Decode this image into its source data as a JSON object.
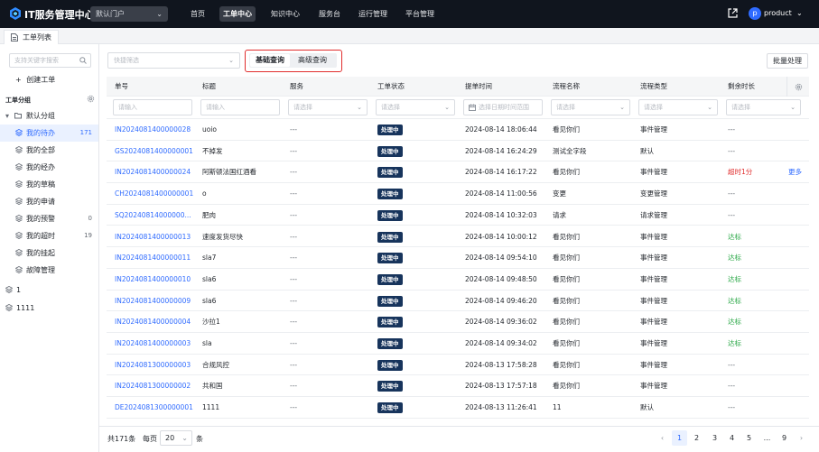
{
  "app": {
    "title": "IT服务管理中心",
    "portal": "默认门户",
    "nav": [
      "首页",
      "工单中心",
      "知识中心",
      "服务台",
      "运行管理",
      "平台管理"
    ],
    "active_nav": "工单中心",
    "user_initial": "p",
    "user": "product"
  },
  "tab": {
    "label": "工单列表"
  },
  "sidebar": {
    "search_placeholder": "支持关键字搜索",
    "create_label": "创建工单",
    "group_header": "工单分组",
    "root": "默认分组",
    "items": [
      {
        "label": "我的待办",
        "count": "171",
        "active": true
      },
      {
        "label": "我的全部",
        "count": ""
      },
      {
        "label": "我的经办",
        "count": ""
      },
      {
        "label": "我的草稿",
        "count": ""
      },
      {
        "label": "我的申请",
        "count": ""
      },
      {
        "label": "我的预警",
        "count": "0"
      },
      {
        "label": "我的超时",
        "count": "19"
      },
      {
        "label": "我的挂起",
        "count": ""
      },
      {
        "label": "故障管理",
        "count": ""
      }
    ],
    "extra_groups": [
      "1",
      "1111"
    ]
  },
  "toolbar": {
    "quick_filter_placeholder": "快捷筛选",
    "basic_query": "基础查询",
    "advanced_query": "高级查询",
    "batch_label": "批量处理"
  },
  "table": {
    "columns": [
      "单号",
      "标题",
      "服务",
      "工单状态",
      "提单时间",
      "流程名称",
      "流程类型",
      "剩余时长"
    ],
    "filters": {
      "input": "请输入",
      "select": "请选择",
      "date": "选择日期时间范围"
    },
    "rows": [
      {
        "id": "IN2024081400000028",
        "title": "uoio",
        "service": "---",
        "status": "处理中",
        "time": "2024-08-14 18:06:44",
        "process": "看见你们",
        "type": "事件管理",
        "remaining": "---",
        "remaining_kind": "dash",
        "more": ""
      },
      {
        "id": "GS2024081400000001",
        "title": "不掉发",
        "service": "---",
        "status": "处理中",
        "time": "2024-08-14 16:24:29",
        "process": "测试全字段",
        "type": "默认",
        "remaining": "---",
        "remaining_kind": "dash",
        "more": ""
      },
      {
        "id": "IN2024081400000024",
        "title": "阿斯顿法国红酒看",
        "service": "---",
        "status": "处理中",
        "time": "2024-08-14 16:17:22",
        "process": "看见你们",
        "type": "事件管理",
        "remaining": "超时1分",
        "remaining_kind": "over",
        "more": "更多"
      },
      {
        "id": "CH2024081400000001",
        "title": "o",
        "service": "---",
        "status": "处理中",
        "time": "2024-08-14 11:00:56",
        "process": "变更",
        "type": "变更管理",
        "remaining": "---",
        "remaining_kind": "dash",
        "more": ""
      },
      {
        "id": "SQ20240814000000...",
        "title": "肥肉",
        "service": "---",
        "status": "处理中",
        "time": "2024-08-14 10:32:03",
        "process": "请求",
        "type": "请求管理",
        "remaining": "---",
        "remaining_kind": "dash",
        "more": ""
      },
      {
        "id": "IN2024081400000013",
        "title": "速度发货尽快",
        "service": "---",
        "status": "处理中",
        "time": "2024-08-14 10:00:12",
        "process": "看见你们",
        "type": "事件管理",
        "remaining": "达标",
        "remaining_kind": "ok",
        "more": ""
      },
      {
        "id": "IN2024081400000011",
        "title": "sla7",
        "service": "---",
        "status": "处理中",
        "time": "2024-08-14 09:54:10",
        "process": "看见你们",
        "type": "事件管理",
        "remaining": "达标",
        "remaining_kind": "ok",
        "more": ""
      },
      {
        "id": "IN2024081400000010",
        "title": "sla6",
        "service": "---",
        "status": "处理中",
        "time": "2024-08-14 09:48:50",
        "process": "看见你们",
        "type": "事件管理",
        "remaining": "达标",
        "remaining_kind": "ok",
        "more": ""
      },
      {
        "id": "IN2024081400000009",
        "title": "sla6",
        "service": "---",
        "status": "处理中",
        "time": "2024-08-14 09:46:20",
        "process": "看见你们",
        "type": "事件管理",
        "remaining": "达标",
        "remaining_kind": "ok",
        "more": ""
      },
      {
        "id": "IN2024081400000004",
        "title": "沙拉1",
        "service": "---",
        "status": "处理中",
        "time": "2024-08-14 09:36:02",
        "process": "看见你们",
        "type": "事件管理",
        "remaining": "达标",
        "remaining_kind": "ok",
        "more": ""
      },
      {
        "id": "IN2024081400000003",
        "title": "sla",
        "service": "---",
        "status": "处理中",
        "time": "2024-08-14 09:34:02",
        "process": "看见你们",
        "type": "事件管理",
        "remaining": "达标",
        "remaining_kind": "ok",
        "more": ""
      },
      {
        "id": "IN2024081300000003",
        "title": "合规风控",
        "service": "---",
        "status": "处理中",
        "time": "2024-08-13 17:58:28",
        "process": "看见你们",
        "type": "事件管理",
        "remaining": "---",
        "remaining_kind": "dash",
        "more": ""
      },
      {
        "id": "IN2024081300000002",
        "title": "共和国",
        "service": "---",
        "status": "处理中",
        "time": "2024-08-13 17:57:18",
        "process": "看见你们",
        "type": "事件管理",
        "remaining": "---",
        "remaining_kind": "dash",
        "more": ""
      },
      {
        "id": "DE2024081300000001",
        "title": "1111",
        "service": "---",
        "status": "处理中",
        "time": "2024-08-13 11:26:41",
        "process": "11",
        "type": "默认",
        "remaining": "---",
        "remaining_kind": "dash",
        "more": ""
      }
    ]
  },
  "footer": {
    "total": "共171条",
    "per_page": "每页",
    "page_size": "20",
    "unit": "条",
    "prev": "‹",
    "next": "›",
    "pages": [
      "1",
      "2",
      "3",
      "4",
      "5",
      "...",
      "9"
    ],
    "current_page": "1"
  },
  "colors": {
    "topbar": "#10151e",
    "accent": "#2f6bff",
    "status_badge": "#17345c",
    "ok": "#28a745",
    "overdue": "#e02d2d",
    "highlight_box": "#e02d2d"
  },
  "icons": [
    "logo-icon",
    "external-link-icon",
    "document-icon",
    "search-icon",
    "plus-icon",
    "gear-icon",
    "folder-icon",
    "layers-icon",
    "calendar-icon",
    "chevron-down-icon"
  ]
}
